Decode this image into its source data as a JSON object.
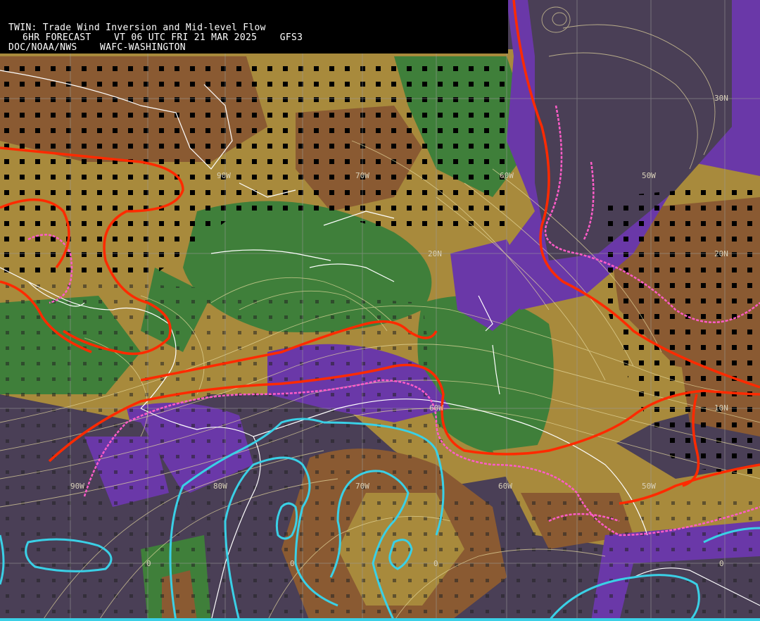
{
  "header": {
    "title": "TWIN: Trade Wind Inversion and Mid-level Flow",
    "forecast_line": "6HR FORECAST    VT 06 UTC FRI 21 MAR 2025    GFS3",
    "agency_line": "DOC/NOAA/NWS    WAFC-WASHINGTON"
  },
  "grid_labels": {
    "lat_30n_east": "30N",
    "lon_90w_top": "90W",
    "lon_70w_top": "70W",
    "lon_60w_top": "60W",
    "lon_50w_top": "50W",
    "lat_20n_mid": "20N",
    "lat_20n_east": "20N",
    "lon_60w_mid": "60W",
    "lat_10n_east": "10N",
    "lon_90w_bottom": "90W",
    "lon_80w_bottom": "80W",
    "lon_70w_bottom": "70W",
    "lon_60w_bottom": "60W",
    "lon_50w_bottom": "50W",
    "lat_0_a": "0",
    "lat_0_b": "0",
    "lat_0_c": "0",
    "lat_0_d": "0"
  },
  "colors": {
    "brown": "#8a5a32",
    "tan": "#a88a3c",
    "green": "#3f7f3a",
    "purple": "#6a38a8",
    "dark_purple": "#4a3f56",
    "red_contour": "#ff2a00",
    "cyan_contour": "#3ad0e6",
    "pink_dashed": "#ff5cc8",
    "graticule": "#9a9a9a",
    "streamline": "#e8dca0",
    "coast": "#ffffff"
  }
}
